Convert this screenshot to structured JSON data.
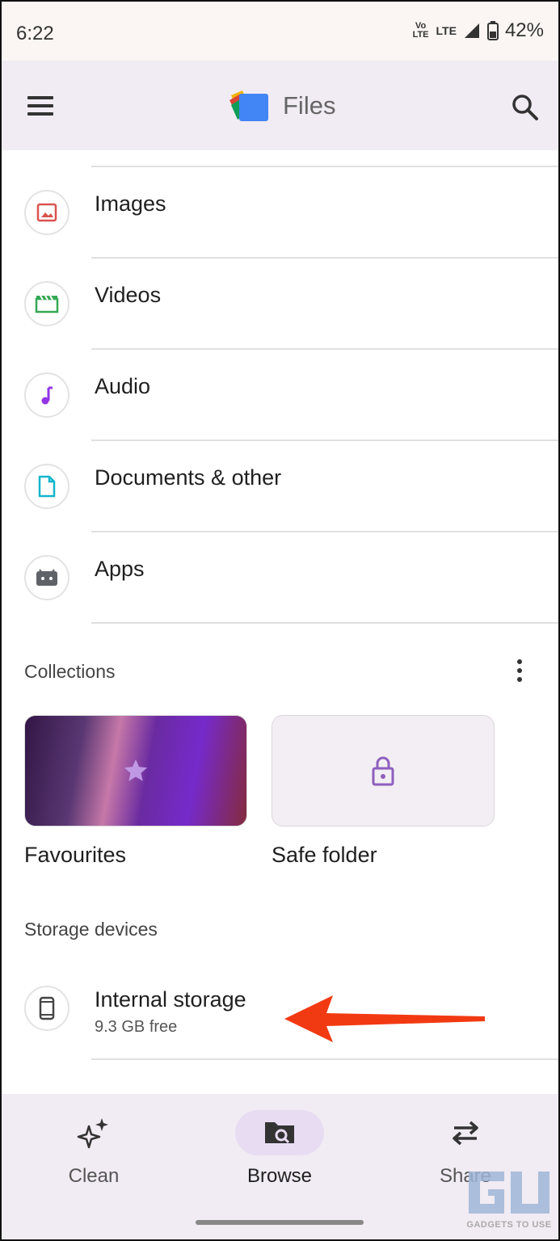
{
  "status_bar": {
    "time": "6:22",
    "volte": "Vo LTE",
    "network": "LTE",
    "battery": "42%"
  },
  "app_bar": {
    "title": "Files"
  },
  "categories": [
    {
      "label": "Images",
      "icon": "image-icon",
      "color": "#d9534f"
    },
    {
      "label": "Videos",
      "icon": "video-icon",
      "color": "#34a853"
    },
    {
      "label": "Audio",
      "icon": "music-note-icon",
      "color": "#9334e6"
    },
    {
      "label": "Documents & other",
      "icon": "document-icon",
      "color": "#12b5cb"
    },
    {
      "label": "Apps",
      "icon": "android-icon",
      "color": "#5f6368"
    }
  ],
  "collections": {
    "title": "Collections",
    "items": [
      {
        "label": "Favourites",
        "icon": "star-icon"
      },
      {
        "label": "Safe folder",
        "icon": "lock-icon"
      }
    ]
  },
  "storage": {
    "title": "Storage devices",
    "items": [
      {
        "name": "Internal storage",
        "free": "9.3 GB free",
        "icon": "phone-icon"
      }
    ]
  },
  "bottom_nav": {
    "items": [
      {
        "label": "Clean",
        "icon": "sparkle-icon",
        "active": false
      },
      {
        "label": "Browse",
        "icon": "browse-icon",
        "active": true
      },
      {
        "label": "Share",
        "icon": "swap-arrows-icon",
        "active": false
      }
    ]
  },
  "watermark": {
    "text": "GADGETS TO USE"
  },
  "colors": {
    "accent": "#e8dcf2",
    "arrow": "#f23a12",
    "app_bar_bg": "#f1ebf3"
  }
}
